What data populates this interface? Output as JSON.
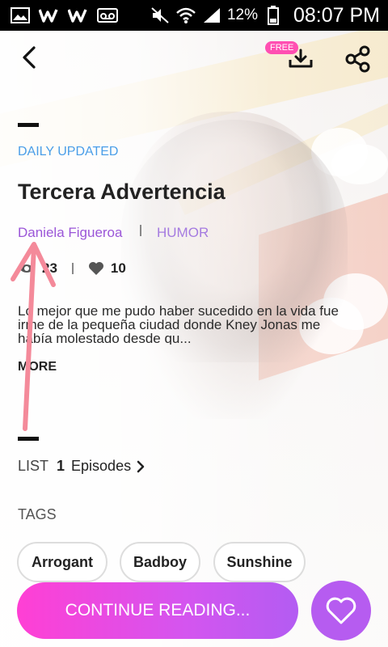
{
  "status_bar": {
    "battery_pct": "12%",
    "time": "08:07 PM",
    "icons": [
      "image-icon",
      "w-app-icon",
      "w-app-icon",
      "voicemail-icon",
      "mute-icon",
      "wifi-icon",
      "signal-icon",
      "battery-icon"
    ]
  },
  "header": {
    "back_icon": "back-icon",
    "free_badge": "FREE",
    "download_icon": "download-icon",
    "share_icon": "share-icon"
  },
  "book": {
    "update_label": "DAILY UPDATED",
    "title": "Tercera Advertencia",
    "author": "Daniela Figueroa",
    "genre": "HUMOR",
    "views": "23",
    "likes": "10",
    "description": "Lo mejor que me pudo haber sucedido en la vida fue irme de la pequeña ciudad donde Kney Jonas me había molestado desde qu...",
    "more_label": "MORE"
  },
  "episodes": {
    "list_label": "LIST",
    "count": "1",
    "episodes_label": "Episodes"
  },
  "tags": {
    "label": "TAGS",
    "items": [
      "Arrogant",
      "Badboy",
      "Sunshine"
    ]
  },
  "actions": {
    "continue_label": "CONTINUE READING...",
    "favorite_icon": "heart-icon"
  },
  "colors": {
    "accent_blue": "#4a9ee8",
    "author_purple": "#9b56d8",
    "cta_start": "#ff3fd4",
    "cta_end": "#b35cf2",
    "annotation_arrow": "#f48a9a"
  }
}
